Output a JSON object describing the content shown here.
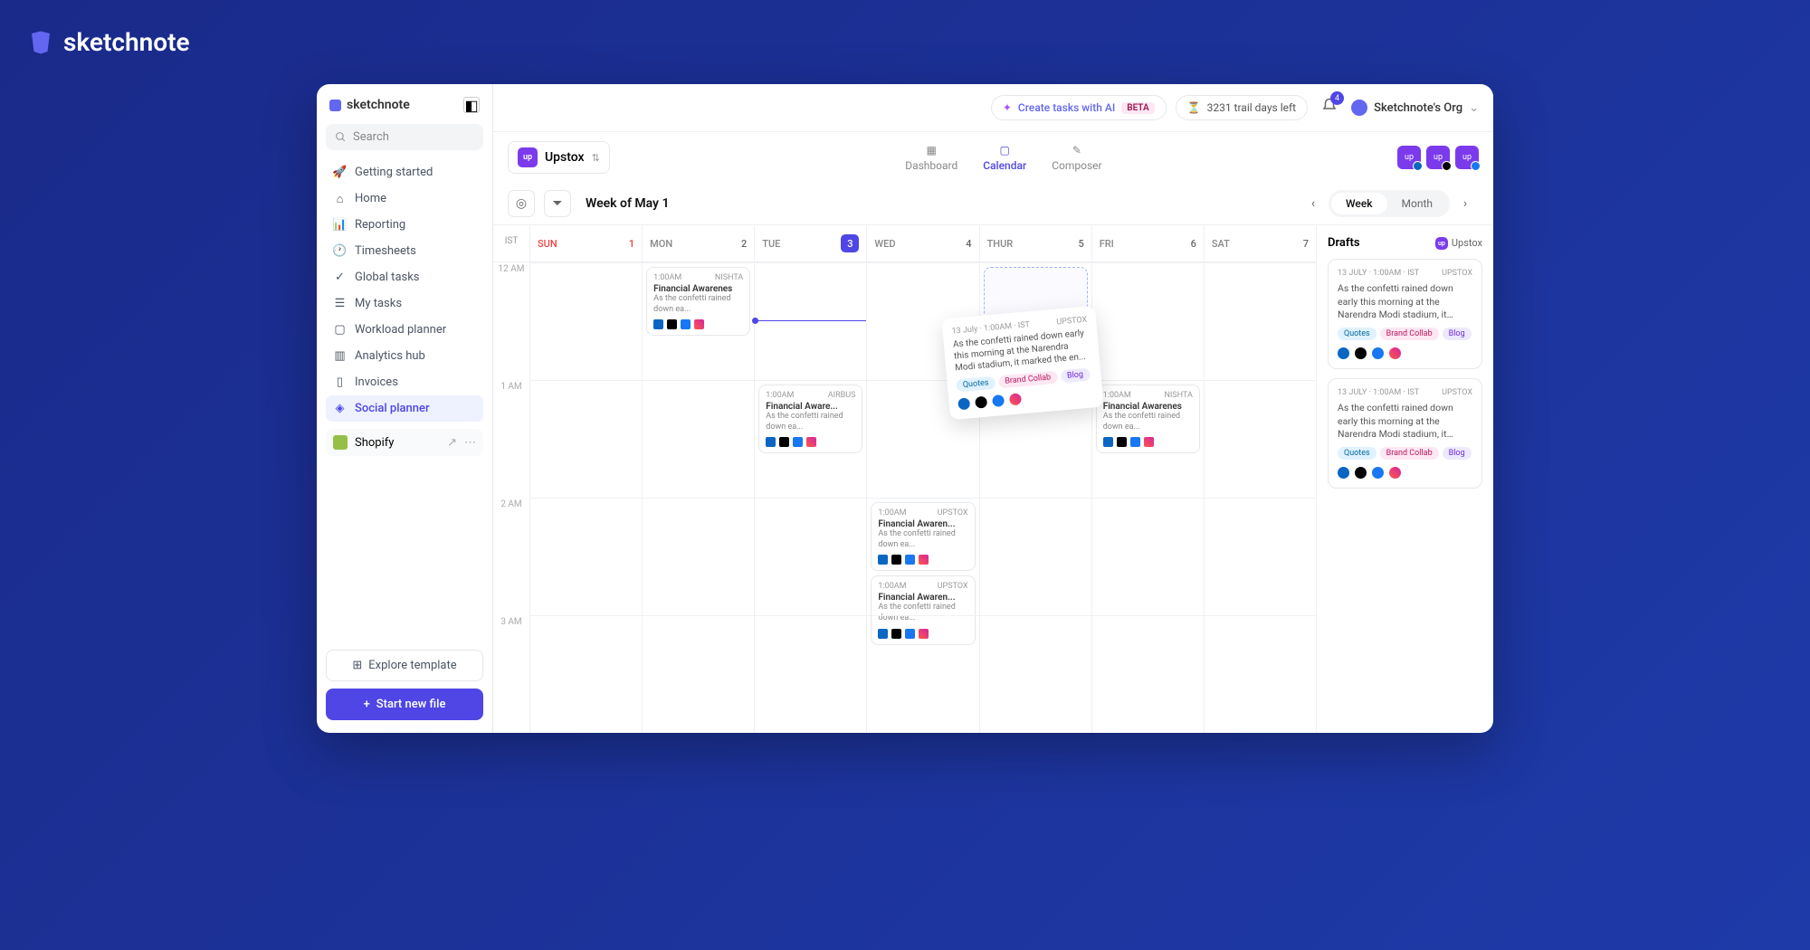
{
  "brand": "sketchnote",
  "sidebar": {
    "logo": "sketchnote",
    "search_placeholder": "Search",
    "nav": [
      {
        "label": "Getting started",
        "icon": "rocket"
      },
      {
        "label": "Home",
        "icon": "home"
      },
      {
        "label": "Reporting",
        "icon": "chart"
      },
      {
        "label": "Timesheets",
        "icon": "clock"
      },
      {
        "label": "Global tasks",
        "icon": "check"
      },
      {
        "label": "My tasks",
        "icon": "list"
      },
      {
        "label": "Workload planner",
        "icon": "calendar"
      },
      {
        "label": "Analytics hub",
        "icon": "bars"
      },
      {
        "label": "Invoices",
        "icon": "file"
      },
      {
        "label": "Social planner",
        "icon": "social",
        "active": true
      }
    ],
    "integration": "Shopify",
    "explore_label": "Explore template",
    "start_label": "Start new file"
  },
  "topbar": {
    "ai_label": "Create tasks with AI",
    "beta": "BETA",
    "trial": "3231 trail days left",
    "notif_count": "4",
    "org": "Sketchnote's Org"
  },
  "workspace": {
    "name": "Upstox",
    "avatar": "up"
  },
  "view_tabs": [
    "Dashboard",
    "Calendar",
    "Composer"
  ],
  "view_active": "Calendar",
  "toolbar": {
    "range": "Week of May 1",
    "modes": [
      "Week",
      "Month"
    ],
    "mode_active": "Week"
  },
  "header": {
    "tz": "IST",
    "days": [
      {
        "name": "SUN",
        "num": "1",
        "sun": true
      },
      {
        "name": "MON",
        "num": "2"
      },
      {
        "name": "TUE",
        "num": "3",
        "today": true
      },
      {
        "name": "WED",
        "num": "4"
      },
      {
        "name": "THUR",
        "num": "5"
      },
      {
        "name": "FRI",
        "num": "6"
      },
      {
        "name": "SAT",
        "num": "7"
      }
    ]
  },
  "hours": [
    "12 AM",
    "1 AM",
    "2 AM",
    "3 AM"
  ],
  "events": {
    "r0c1": {
      "time": "1:00AM",
      "author": "NISHTA",
      "title": "Financial Awarenes",
      "desc": "As the confetti rained down ea..."
    },
    "r1c2": {
      "time": "1:00AM",
      "author": "AIRBUS",
      "title": "Financial Aware...",
      "desc": "As the confetti rained down ea..."
    },
    "r1c5": {
      "time": "1:00AM",
      "author": "NISHTA",
      "title": "Financial Awarenes",
      "desc": "As the confetti rained down ea..."
    },
    "r2c3a": {
      "time": "1:00AM",
      "author": "UPSTOX",
      "title": "Financial Awaren...",
      "desc": "As the confetti rained down ea..."
    },
    "r2c3b": {
      "time": "1:00AM",
      "author": "UPSTOX",
      "title": "Financial Awaren...",
      "desc": "As the confetti rained down ea..."
    }
  },
  "ghost": {
    "meta_left": "13 July · 1:00AM · IST",
    "meta_right": "UPSTOX",
    "desc": "As the confetti rained down early this morning at the Narendra Modi stadium, it marked the en...",
    "tags": [
      "Quotes",
      "Brand Collab",
      "Blog"
    ]
  },
  "drafts": {
    "title": "Drafts",
    "ws": "Upstox",
    "cards": [
      {
        "meta_left": "13 JULY · 1:00AM · IST",
        "meta_right": "UPSTOX",
        "text": "As the confetti rained down early this morning at the Narendra Modi stadium, it marked the en...",
        "tags": [
          "Quotes",
          "Brand Collab",
          "Blog"
        ]
      },
      {
        "meta_left": "13 JULY · 1:00AM · IST",
        "meta_right": "UPSTOX",
        "text": "As the confetti rained down early this morning at the Narendra Modi stadium, it marked the en...",
        "tags": [
          "Quotes",
          "Brand Collab",
          "Blog"
        ]
      }
    ]
  }
}
